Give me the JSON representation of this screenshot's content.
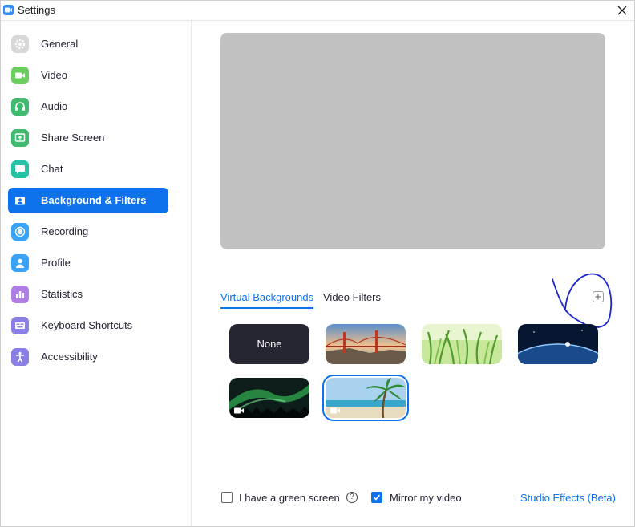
{
  "window": {
    "title": "Settings",
    "app_icon": "video-camera-icon",
    "close_icon": "close-icon"
  },
  "sidebar": {
    "items": [
      {
        "label": "General",
        "icon": "gear-icon",
        "color": "#d8d8d8",
        "active": false
      },
      {
        "label": "Video",
        "icon": "video-camera-icon",
        "color": "#6bcf5d",
        "active": false
      },
      {
        "label": "Audio",
        "icon": "headphones-icon",
        "color": "#3fba6f",
        "active": false
      },
      {
        "label": "Share Screen",
        "icon": "share-screen-icon",
        "color": "#3fba6f",
        "active": false
      },
      {
        "label": "Chat",
        "icon": "chat-bubble-icon",
        "color": "#26c2a6",
        "active": false
      },
      {
        "label": "Background & Filters",
        "icon": "portrait-icon",
        "color": "#0e72ed",
        "active": true
      },
      {
        "label": "Recording",
        "icon": "record-icon",
        "color": "#3aa3f5",
        "active": false
      },
      {
        "label": "Profile",
        "icon": "person-icon",
        "color": "#3aa3f5",
        "active": false
      },
      {
        "label": "Statistics",
        "icon": "bar-chart-icon",
        "color": "#b07fe6",
        "active": false
      },
      {
        "label": "Keyboard Shortcuts",
        "icon": "keyboard-icon",
        "color": "#8a7fe6",
        "active": false
      },
      {
        "label": "Accessibility",
        "icon": "accessibility-icon",
        "color": "#8a7fe6",
        "active": false
      }
    ]
  },
  "main": {
    "tabs": [
      {
        "label": "Virtual Backgrounds",
        "active": true
      },
      {
        "label": "Video Filters",
        "active": false
      }
    ],
    "add_button_icon": "plus-icon",
    "backgrounds": [
      {
        "label": "None",
        "kind": "none",
        "selected": false
      },
      {
        "kind": "golden-gate-bridge",
        "selected": false,
        "video": false
      },
      {
        "kind": "grass",
        "selected": false,
        "video": false
      },
      {
        "kind": "earth-from-space",
        "selected": false,
        "video": false
      },
      {
        "kind": "aurora",
        "selected": false,
        "video": true
      },
      {
        "kind": "beach-palm",
        "selected": true,
        "video": true
      }
    ],
    "options": {
      "green_screen": {
        "label": "I have a green screen",
        "checked": false
      },
      "help_icon": "question-circle-icon",
      "mirror": {
        "label": "Mirror my video",
        "checked": true
      },
      "studio_effects": "Studio Effects (Beta)"
    }
  },
  "colors": {
    "accent": "#0e72ed",
    "preview": "#c1c1c1",
    "annotation": "#1a24c9"
  }
}
